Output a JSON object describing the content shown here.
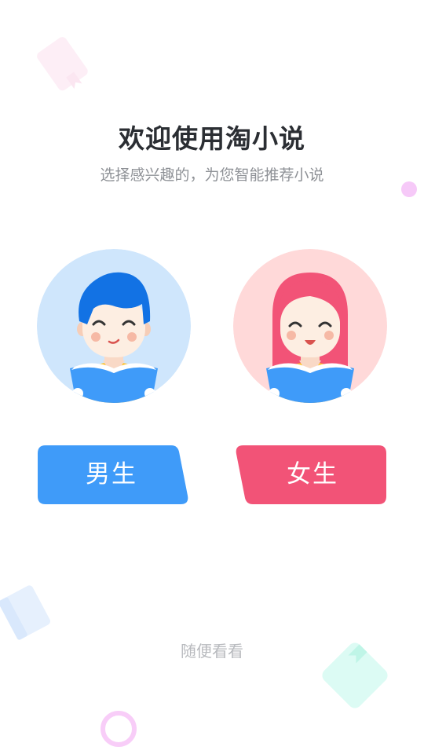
{
  "welcome": {
    "title": "欢迎使用淘小说",
    "subtitle": "选择感兴趣的，为您智能推荐小说"
  },
  "gender": {
    "male_label": "男生",
    "female_label": "女生"
  },
  "skip_label": "随便看看",
  "colors": {
    "male_accent": "#3f9bf9",
    "female_accent": "#f25377",
    "male_bg": "#cfe6fc",
    "female_bg": "#ffd9d9"
  },
  "icons": {
    "male_avatar": "boy-reading-icon",
    "female_avatar": "girl-reading-icon"
  }
}
